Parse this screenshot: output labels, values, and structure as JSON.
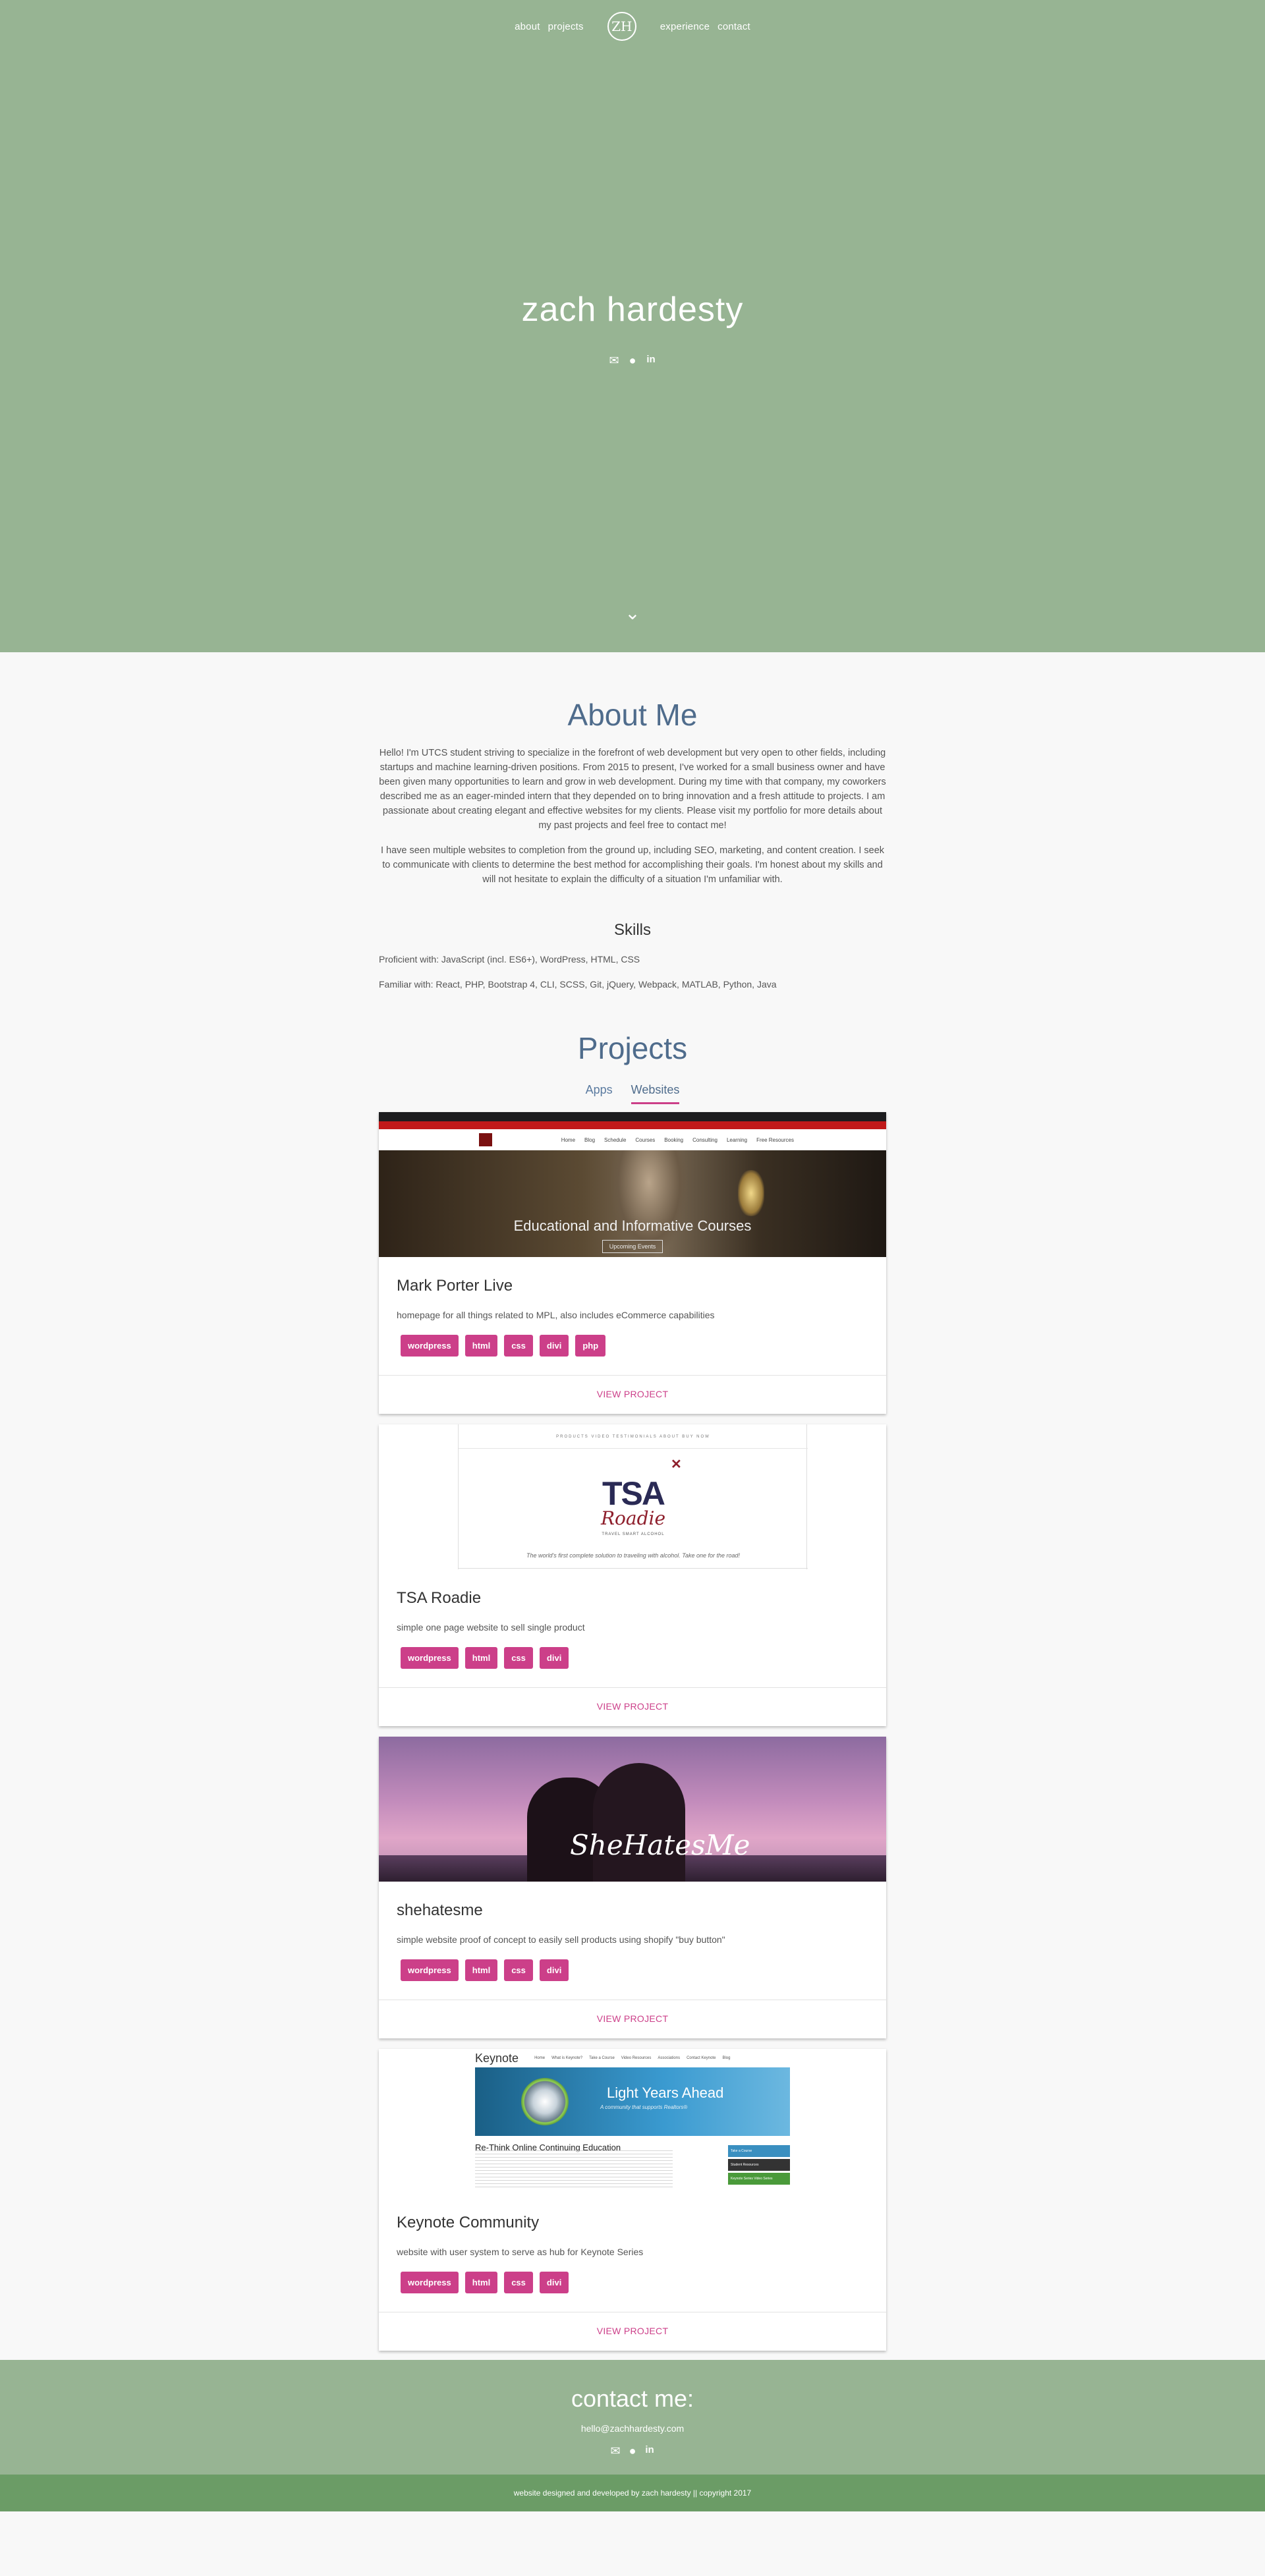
{
  "nav": {
    "left": [
      "about",
      "projects"
    ],
    "logo": "ZH",
    "right": [
      "experience",
      "contact"
    ]
  },
  "hero": {
    "name": "zach hardesty",
    "icons": [
      "envelope-icon",
      "github-icon",
      "linkedin-icon"
    ]
  },
  "about": {
    "title": "About Me",
    "p1": "Hello! I'm UTCS student striving to specialize in the forefront of web development but very open to other fields, including startups and machine learning-driven positions. From 2015 to present, I've worked for a small business owner and have been given many opportunities to learn and grow in web development. During my time with that company, my coworkers described me as an eager-minded intern that they depended on to bring innovation and a fresh attitude to projects. I am passionate about creating elegant and effective websites for my clients. Please visit my portfolio for more details about my past projects and feel free to contact me!",
    "p2": "I have seen multiple websites to completion from the ground up, including SEO, marketing, and content creation. I seek to communicate with clients to determine the best method for accomplishing their goals. I'm honest about my skills and will not hesitate to explain the difficulty of a situation I'm unfamiliar with.",
    "skills_title": "Skills",
    "proficient": "Proficient with: JavaScript (incl. ES6+), WordPress, HTML, CSS",
    "familiar": "Familiar with: React, PHP, Bootstrap 4, CLI, SCSS, Git, jQuery, Webpack, MATLAB, Python, Java"
  },
  "projects": {
    "title": "Projects",
    "tabs": [
      "Apps",
      "Websites"
    ],
    "active_tab": "Websites",
    "action_label": "VIEW PROJECT",
    "items": [
      {
        "title": "Mark Porter Live",
        "desc": "homepage for all things related to MPL, also includes eCommerce capabilities",
        "tags": [
          "wordpress",
          "html",
          "css",
          "divi",
          "php"
        ],
        "thumb_caption": "Educational and Informative Courses",
        "thumb_button": "Upcoming Events",
        "thumb_menu": [
          "Home",
          "Blog",
          "Schedule",
          "Courses",
          "Booking",
          "Consulting",
          "Learning",
          "Free Resources"
        ]
      },
      {
        "title": "TSA Roadie",
        "desc": "simple one page website to sell single product",
        "tags": [
          "wordpress",
          "html",
          "css",
          "divi"
        ],
        "thumb_menu": "PRODUCTS   VIDEO   TESTIMONIALS   ABOUT   BUY NOW",
        "thumb_logo": "TSA",
        "thumb_logo2": "Roadie",
        "thumb_sub": "TRAVEL SMART ALCOHOL",
        "thumb_quote": "The world's first complete solution to traveling with alcohol. Take one for the road!"
      },
      {
        "title": "shehatesme",
        "desc": "simple website proof of concept to easily sell products using shopify \"buy button\"",
        "tags": [
          "wordpress",
          "html",
          "css",
          "divi"
        ],
        "thumb_signature": "SheHatesMe"
      },
      {
        "title": "Keynote Community",
        "desc": "website with user system to serve as hub for Keynote Series",
        "tags": [
          "wordpress",
          "html",
          "css",
          "divi"
        ],
        "thumb_brand": "Keynote",
        "thumb_menu": [
          "Home",
          "What is Keynote?",
          "Take a Course",
          "Video Resources",
          "Associations",
          "Contact Keynote",
          "Blog"
        ],
        "thumb_banner": "Light Years Ahead",
        "thumb_banner_sub": "A community that supports Realtors®",
        "thumb_heading": "Re-Think Online Continuing Education",
        "thumb_side": [
          "Take a Course",
          "Student Resources",
          "Keynote Series Video Series"
        ]
      }
    ]
  },
  "contact": {
    "title": "contact me:",
    "email": "hello@zachhardesty.com",
    "icons": [
      "envelope-icon",
      "github-icon",
      "linkedin-icon"
    ]
  },
  "footer": {
    "copyright": "website designed and developed by zach hardesty || copyright 2017"
  },
  "colors": {
    "hero_green": "#97b493",
    "footer_green": "#6b9c66",
    "accent_pink": "#cc3f89",
    "heading_blue": "#4f6c8c"
  }
}
